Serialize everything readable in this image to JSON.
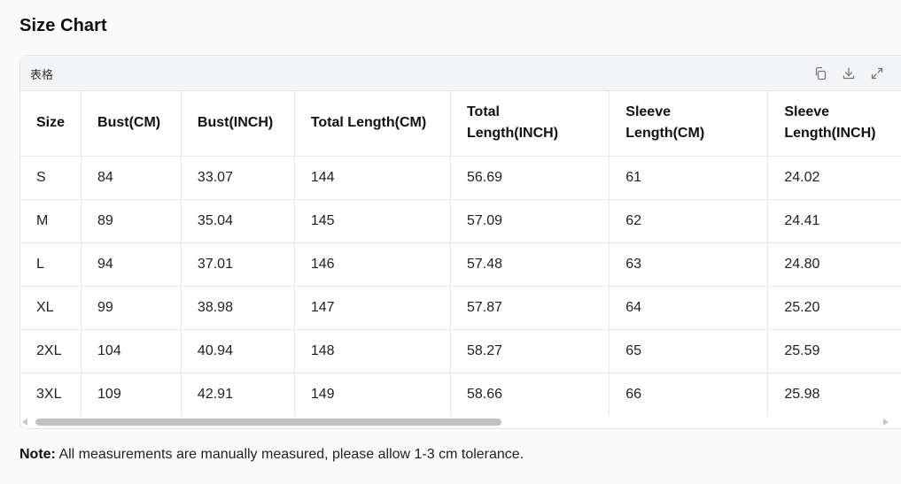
{
  "page": {
    "title": "Size Chart"
  },
  "card": {
    "title": "表格",
    "tools": [
      {
        "name": "copy-icon"
      },
      {
        "name": "download-icon"
      },
      {
        "name": "expand-icon"
      }
    ]
  },
  "table": {
    "headers": [
      "Size",
      "Bust(CM)",
      "Bust(INCH)",
      "Total Length(CM)",
      "Total Length(INCH)",
      "Sleeve Length(CM)",
      "Sleeve Length(INCH)"
    ],
    "rows": [
      [
        "S",
        "84",
        "33.07",
        "144",
        "56.69",
        "61",
        "24.02"
      ],
      [
        "M",
        "89",
        "35.04",
        "145",
        "57.09",
        "62",
        "24.41"
      ],
      [
        "L",
        "94",
        "37.01",
        "146",
        "57.48",
        "63",
        "24.80"
      ],
      [
        "XL",
        "99",
        "38.98",
        "147",
        "57.87",
        "64",
        "25.20"
      ],
      [
        "2XL",
        "104",
        "40.94",
        "148",
        "58.27",
        "65",
        "25.59"
      ],
      [
        "3XL",
        "109",
        "42.91",
        "149",
        "58.66",
        "66",
        "25.98"
      ]
    ]
  },
  "note": {
    "label": "Note:",
    "text": " All measurements are manually measured, please allow 1-3 cm tolerance."
  }
}
